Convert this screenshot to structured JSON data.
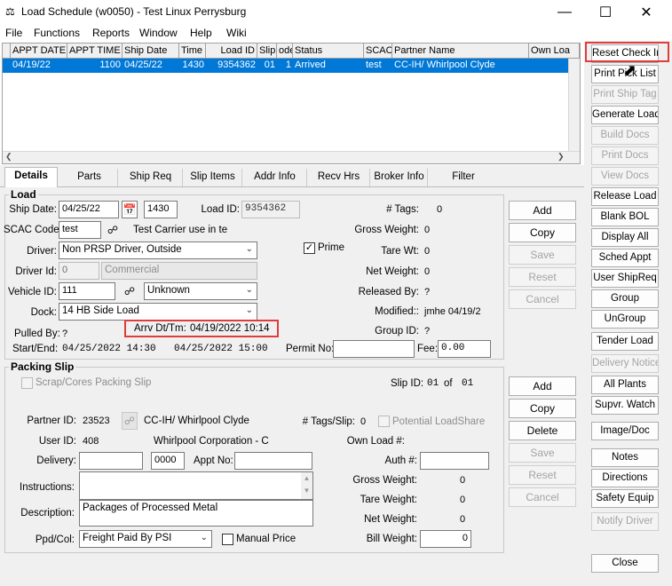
{
  "window": {
    "title": "Load Schedule (w0050) - Test Linux Perrysburg",
    "app_icon": "scale-icon"
  },
  "menu": [
    "File",
    "Functions",
    "Reports",
    "Window",
    "Help",
    "Wiki"
  ],
  "grid": {
    "headers": [
      "APPT DATE",
      "APPT TIME",
      "Ship Date",
      "Time",
      "Load ID",
      "Slip",
      "ode",
      "Status",
      "SCAC",
      "Partner Name",
      "Own Loa"
    ],
    "row": [
      "04/19/22",
      "1100",
      "04/25/22",
      "1430",
      "9354362",
      "01",
      "1",
      "Arrived",
      "test",
      "CC-IH/ Whirlpool Clyde",
      ""
    ]
  },
  "tabs": [
    "Details",
    "Parts",
    "Ship Req",
    "Slip Items",
    "Addr Info",
    "Recv Hrs",
    "Broker Info",
    "Filter"
  ],
  "load": {
    "group_title": "Load",
    "ship_date_label": "Ship Date:",
    "ship_date": "04/25/22",
    "ship_time": "1430",
    "load_id_label": "Load ID:",
    "load_id": "9354362",
    "tags_label": "# Tags:",
    "tags": "0",
    "scac_label": "SCAC Code:",
    "scac": "test",
    "carrier_note": "Test Carrier use in te",
    "gross_label": "Gross Weight:",
    "gross": "0",
    "driver_label": "Driver:",
    "driver": "Non PRSP Driver, Outside",
    "prime_label": "Prime",
    "prime_checked": "✓",
    "tare_label": "Tare Wt:",
    "tare": "0",
    "driver_id_label": "Driver Id:",
    "driver_id": "0",
    "driver_type": "Commercial",
    "net_label": "Net Weight:",
    "net": "0",
    "vehicle_label": "Vehicle ID:",
    "vehicle_id": "111",
    "vehicle_type": "Unknown",
    "released_label": "Released By:",
    "released": "?",
    "dock_label": "Dock:",
    "dock": "14 HB Side Load",
    "modified_label": "Modified::",
    "modified": "jmhe 04/19/2",
    "pulled_label": "Pulled By:",
    "pulled": "?",
    "arrv_label": "Arrv Dt/Tm:",
    "arrv": "04/19/2022 10:14",
    "groupid_label": "Group ID:",
    "groupid": "?",
    "startend_label": "Start/End:",
    "start": "04/25/2022 14:30",
    "end": "04/25/2022 15:00",
    "permit_label": "Permit No:",
    "permit": "",
    "fee_label": "Fee:",
    "fee": "0.00"
  },
  "load_buttons": [
    "Add",
    "Copy",
    "Save",
    "Reset",
    "Cancel"
  ],
  "slip": {
    "group_title": "Packing Slip",
    "scrap_label": "Scrap/Cores Packing Slip",
    "slip_id_label": "Slip ID:",
    "slip_id": "01",
    "of_label": "of",
    "slip_total": "01",
    "partner_label": "Partner ID:",
    "partner_id": "23523",
    "partner_name": "CC-IH/ Whirlpool Clyde",
    "tags_label": "# Tags/Slip:",
    "tags": "0",
    "share_label": "Potential LoadShare",
    "user_label": "User ID:",
    "user_id": "408",
    "user_name": "Whirlpool Corporation - C",
    "ownload_label": "Own Load #:",
    "delivery_label": "Delivery:",
    "delivery": "",
    "delivery_time": "0000",
    "appt_label": "Appt No:",
    "appt": "",
    "auth_label": "Auth #:",
    "auth": "",
    "instr_label": "Instructions:",
    "instructions": "",
    "gross_label": "Gross Weight:",
    "gross": "0",
    "tare_label": "Tare Weight:",
    "tare": "0",
    "desc_label": "Description:",
    "description": "Packages of Processed Metal",
    "net_label": "Net Weight:",
    "net": "0",
    "ppd_label": "Ppd/Col:",
    "ppd": "Freight Paid By PSI",
    "manual_label": "Manual Price",
    "bill_label": "Bill Weight:",
    "bill": "0"
  },
  "slip_buttons": [
    "Add",
    "Copy",
    "Delete",
    "Save",
    "Reset",
    "Cancel"
  ],
  "side_buttons": [
    "Reset Check In",
    "Print Pick List",
    "Print Ship Tag",
    "Generate Load",
    "Build Docs",
    "Print Docs",
    "View Docs",
    "Release Load",
    "Blank BOL",
    "Display All",
    "Sched Appt",
    "User ShipReq",
    "Group",
    "UnGroup",
    "Tender Load",
    "Delivery Notice",
    "All Plants",
    "Supvr. Watch",
    "Image/Doc",
    "Notes",
    "Directions",
    "Safety Equip",
    "Notify Driver",
    "Close"
  ],
  "colors": {
    "selection": "#0078d7",
    "highlight": "#e03c3c"
  }
}
